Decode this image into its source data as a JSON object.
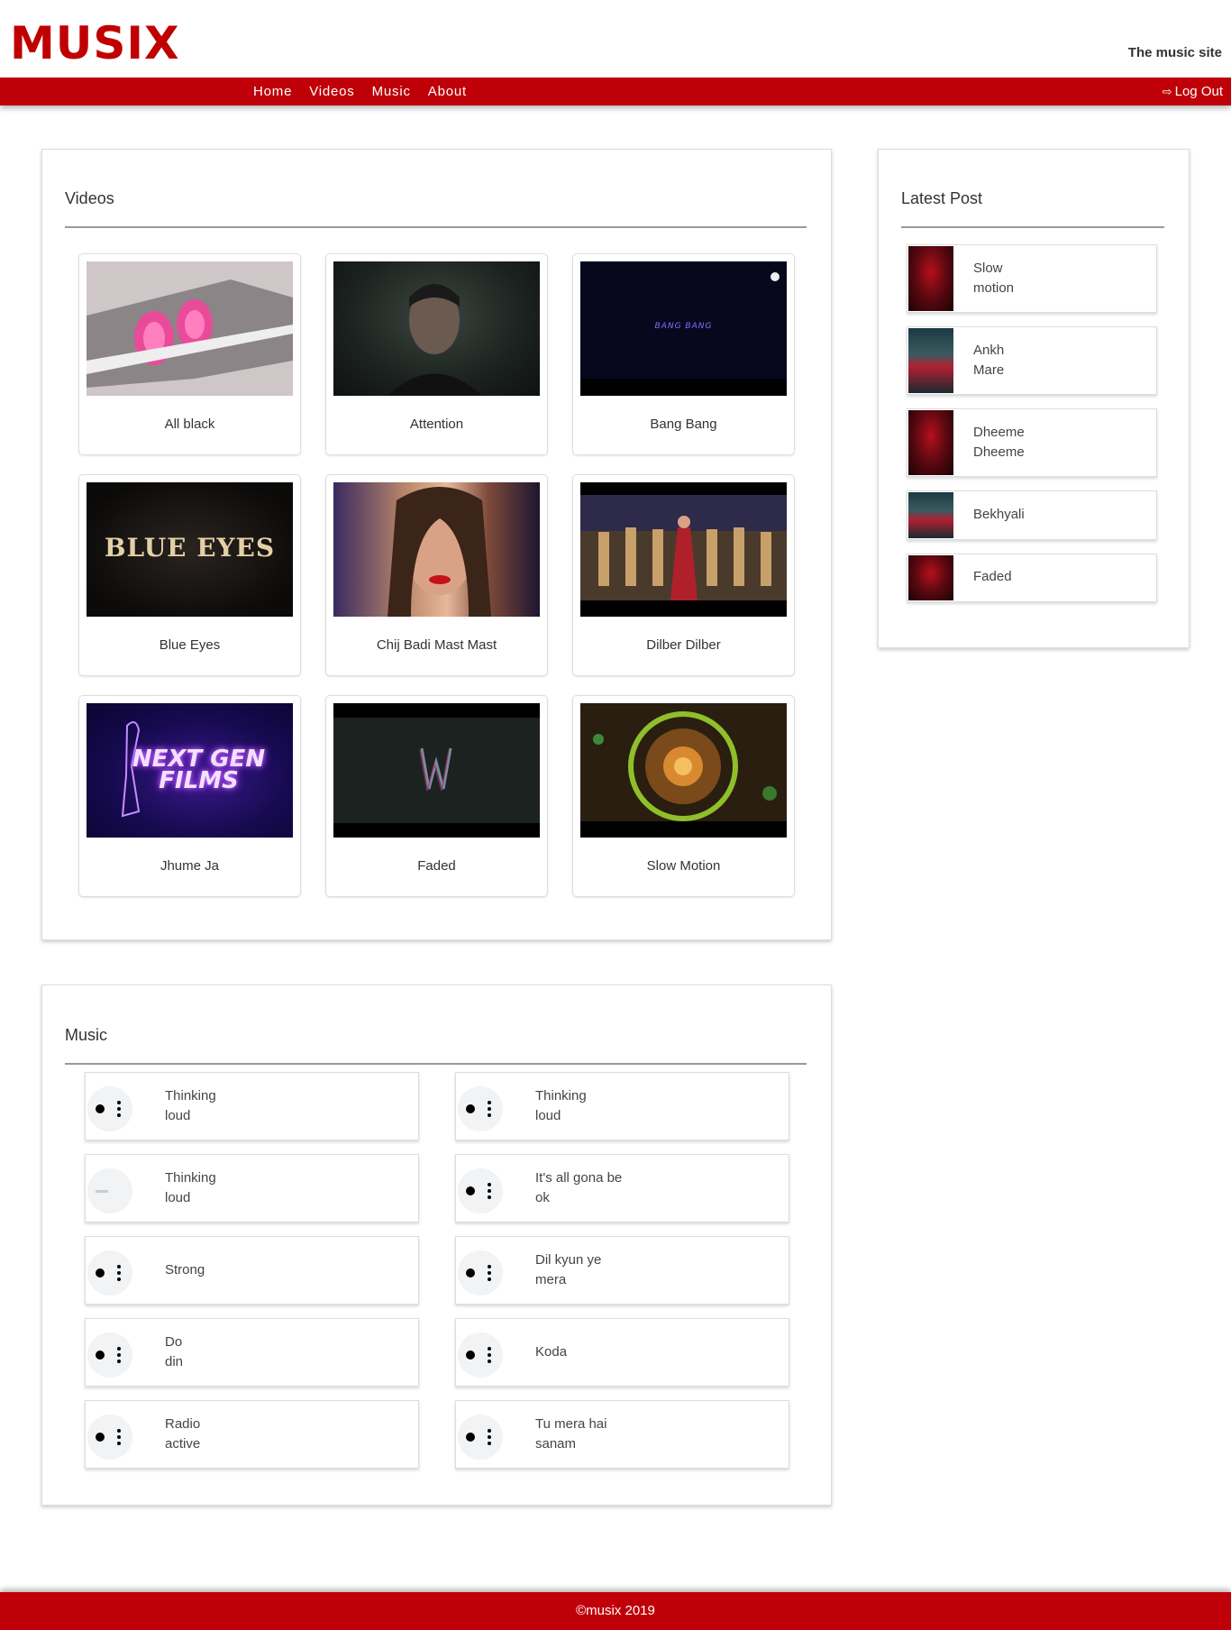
{
  "header": {
    "logo": "MUSIX",
    "tagline": "The music site"
  },
  "nav": {
    "links": [
      "Home",
      "Videos",
      "Music",
      "About"
    ],
    "logout_label": "Log Out"
  },
  "videos": {
    "title": "Videos",
    "items": [
      {
        "label": "All black"
      },
      {
        "label": "Attention"
      },
      {
        "label": "Bang Bang",
        "thumb_text": "BANG BANG"
      },
      {
        "label": "Blue Eyes",
        "thumb_text": "BLUE EYES"
      },
      {
        "label": "Chij Badi Mast Mast"
      },
      {
        "label": "Dilber Dilber"
      },
      {
        "label": "Jhume Ja",
        "thumb_text": "NEXT GEN FILMS"
      },
      {
        "label": "Faded"
      },
      {
        "label": "Slow Motion"
      }
    ]
  },
  "latest": {
    "title": "Latest Post",
    "items": [
      {
        "line1": "Slow",
        "line2": "motion"
      },
      {
        "line1": "Ankh",
        "line2": "Mare"
      },
      {
        "line1": "Dheeme",
        "line2": "Dheeme"
      },
      {
        "line1": "Bekhyali",
        "line2": ""
      },
      {
        "line1": "Faded",
        "line2": ""
      }
    ]
  },
  "music": {
    "title": "Music",
    "items": [
      {
        "line1": "Thinking",
        "line2": "loud"
      },
      {
        "line1": "Thinking",
        "line2": "loud"
      },
      {
        "line1": "Thinking",
        "line2": "loud"
      },
      {
        "line1": "It's all gona be",
        "line2": "ok"
      },
      {
        "line1": "Strong",
        "line2": ""
      },
      {
        "line1": "Dil kyun ye",
        "line2": "mera"
      },
      {
        "line1": "Do",
        "line2": "din"
      },
      {
        "line1": "Koda",
        "line2": ""
      },
      {
        "line1": "Radio",
        "line2": "active"
      },
      {
        "line1": "Tu mera hai",
        "line2": "sanam"
      }
    ]
  },
  "footer": {
    "text": "©musix 2019"
  },
  "colors": {
    "brand": "#c00008",
    "logo": "#c00000"
  }
}
